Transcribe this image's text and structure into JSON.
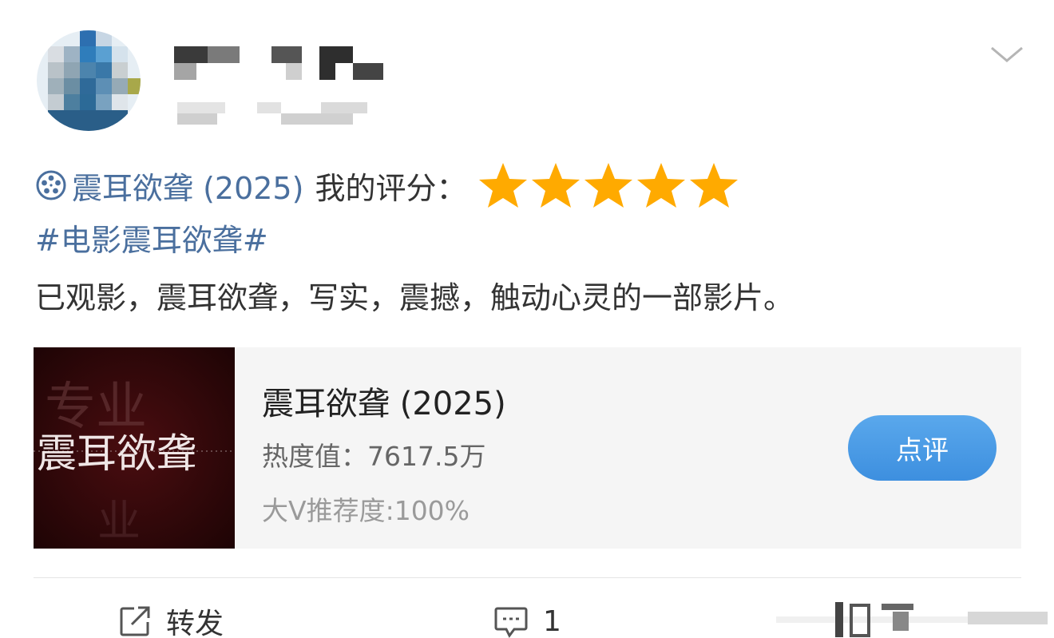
{
  "header": {
    "avatar_icon": "avatar-pixelated",
    "menu_icon": "chevron-down-icon"
  },
  "post": {
    "film_icon": "film-reel-icon",
    "film_link": "震耳欲聋 (2025)",
    "rating_label": "我的评分：",
    "rating": {
      "value": 5,
      "max": 5,
      "color": "#ffaa00"
    },
    "hashtag": "#电影震耳欲聋#",
    "text": "已观影，震耳欲聋，写实，震撼，触动心灵的一部影片。"
  },
  "card": {
    "poster_text": "震耳欲聋",
    "title": "震耳欲聋 (2025)",
    "heat": "热度值：7617.5万",
    "recommend": "大V推荐度:100%",
    "button": "点评",
    "button_color": "#4a9ae6"
  },
  "actions": {
    "repost_icon": "share-icon",
    "repost": "转发",
    "comment_icon": "comment-icon",
    "comment_count": "1",
    "like_icon": "like-icon"
  },
  "colors": {
    "link": "#4a6f9e",
    "text": "#333333",
    "star": "#ffaa00"
  }
}
